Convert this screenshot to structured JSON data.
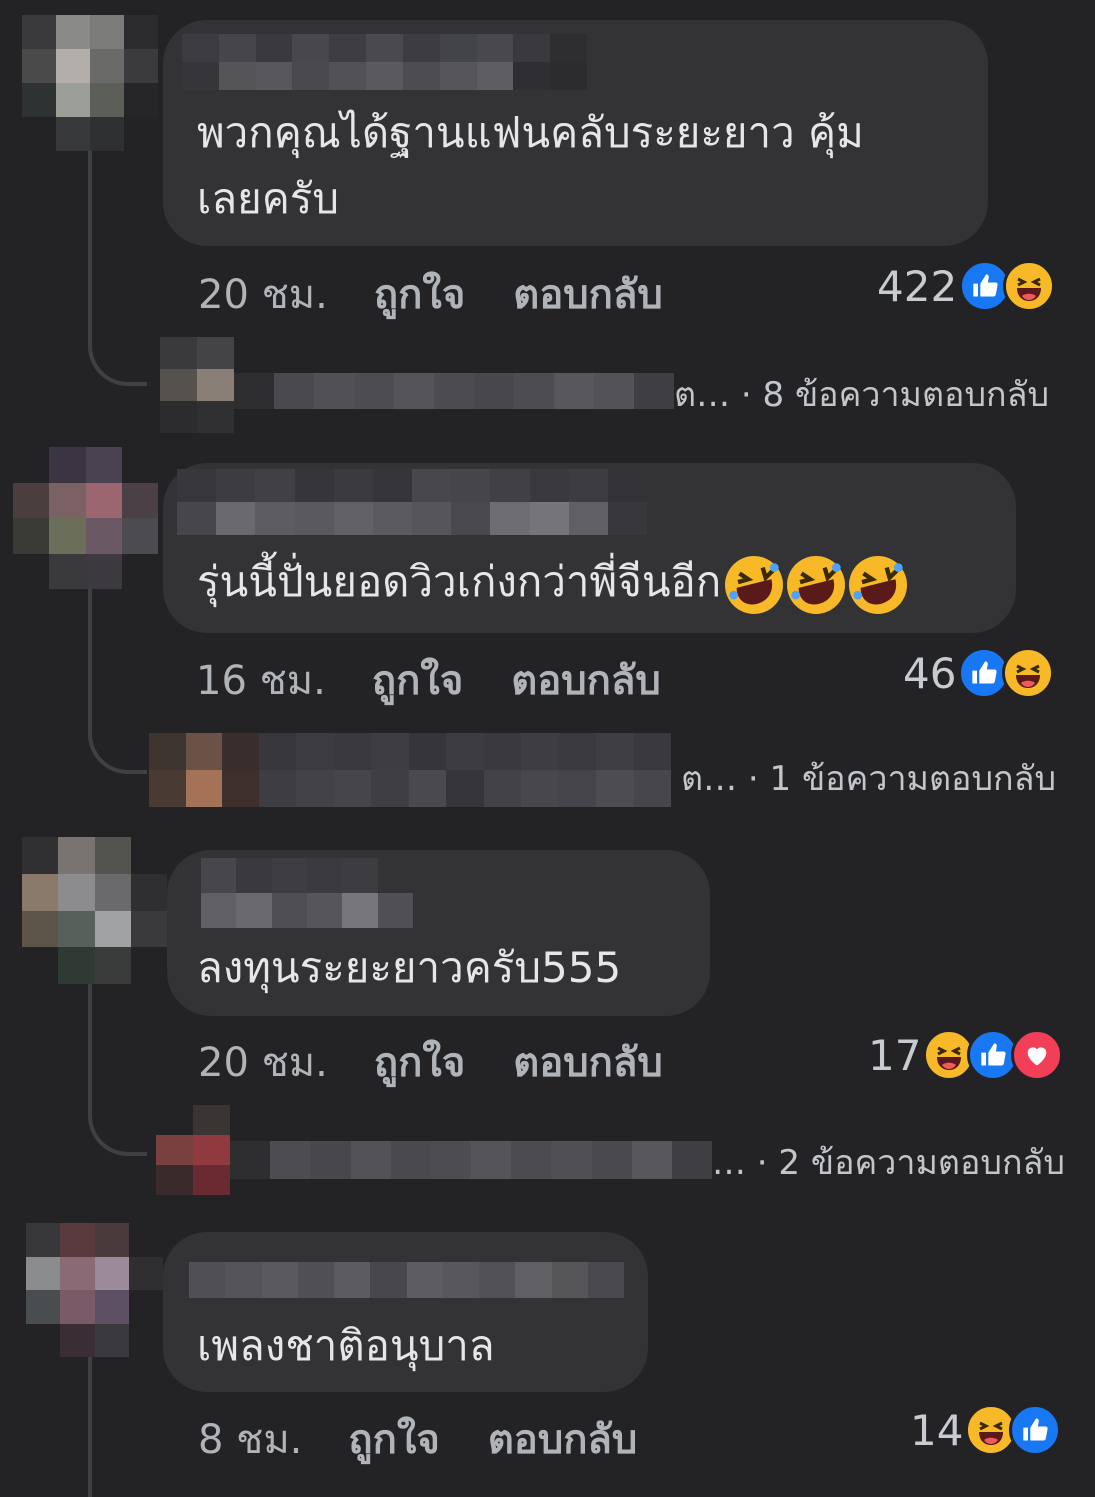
{
  "colors": {
    "background": "#232326",
    "bubble": "#333336",
    "like": "#1877f2",
    "haha": "#f7b928",
    "love": "#f33e58"
  },
  "comments": [
    {
      "text": "พวกคุณได้ฐานแฟนคลับระยะยาว คุ้ม\nเลยครับ",
      "time": "20 ชม.",
      "like_label": "ถูกใจ",
      "reply_label": "ตอบกลับ",
      "reaction_count": "422",
      "reactions": [
        "like-icon",
        "haha-icon"
      ],
      "replies_preview": "ต… · 8 ข้อความตอบกลับ"
    },
    {
      "text": "รุ่นนี้ปั่นยอดวิวเก่งกว่าพี่จีนอีก",
      "emojis": [
        "rofl-emoji",
        "rofl-emoji",
        "rofl-emoji"
      ],
      "time": "16 ชม.",
      "like_label": "ถูกใจ",
      "reply_label": "ตอบกลับ",
      "reaction_count": "46",
      "reactions": [
        "like-icon",
        "haha-icon"
      ],
      "replies_preview": "ต… · 1 ข้อความตอบกลับ"
    },
    {
      "text": "ลงทุนระยะยาวครับ555",
      "time": "20 ชม.",
      "like_label": "ถูกใจ",
      "reply_label": "ตอบกลับ",
      "reaction_count": "17",
      "reactions": [
        "haha-icon",
        "like-icon",
        "love-icon"
      ],
      "replies_preview": "… · 2 ข้อความตอบกลับ"
    },
    {
      "text": "เพลงชาติอนุบาล",
      "time": "8 ชม.",
      "like_label": "ถูกใจ",
      "reply_label": "ตอบกลับ",
      "reaction_count": "14",
      "reactions": [
        "haha-icon",
        "like-icon"
      ]
    }
  ]
}
